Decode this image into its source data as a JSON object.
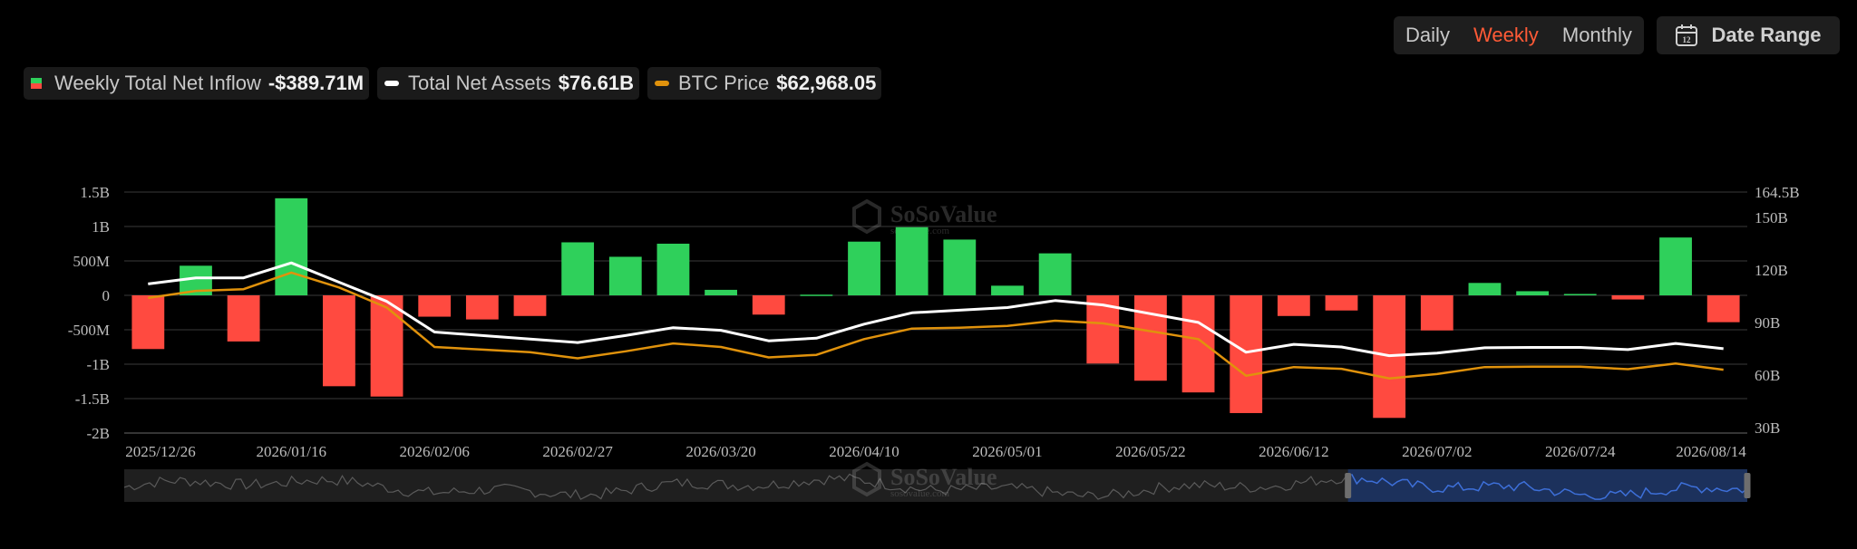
{
  "controls": {
    "periods": [
      "Daily",
      "Weekly",
      "Monthly"
    ],
    "active_period": "Weekly",
    "date_range_label": "Date Range",
    "calendar_icon": "calendar-icon",
    "calendar_icon_text": "12"
  },
  "legend": {
    "inflow_label": "Weekly Total Net Inflow",
    "inflow_value": "-$389.71M",
    "assets_label": "Total Net Assets",
    "assets_value": "$76.61B",
    "btc_label": "BTC Price",
    "btc_value": "$62,968.05"
  },
  "watermark": {
    "brand": "SoSoValue",
    "subtitle": "sosovalue.com"
  },
  "colors": {
    "positive": "#2fd05b",
    "negative": "#ff4a40",
    "assets_line": "#ffffff",
    "btc_line": "#e0920c",
    "accent": "#ff5a36",
    "grid": "#3a3a3a",
    "zoom_fill": "#1c3360"
  },
  "chart_data": {
    "type": "bar",
    "title": "",
    "xlabel": "",
    "ylabel": "",
    "x_tick_labels": [
      "2025/12/26",
      "2026/01/16",
      "2026/02/06",
      "2026/02/27",
      "2026/03/20",
      "2026/04/10",
      "2026/05/01",
      "2026/05/22",
      "2026/06/12",
      "2026/07/02",
      "2026/07/24",
      "2026/08/14"
    ],
    "y_left_ticks": [
      "1.5B",
      "1B",
      "500M",
      "0",
      "-500M",
      "-1B",
      "-1.5B",
      "-2B"
    ],
    "y_left_ticks_values": [
      1500,
      1000,
      500,
      0,
      -500,
      -1000,
      -1500,
      -2000
    ],
    "y_left_unit": "M USD",
    "ylim_left": [
      -2000,
      1500
    ],
    "y_right_ticks": [
      "164.5B",
      "150B",
      "120B",
      "90B",
      "60B",
      "30B"
    ],
    "y_right_ticks_values": [
      164.5,
      150,
      120,
      90,
      60,
      30
    ],
    "ylim_right": [
      26.8,
      164.5
    ],
    "grid": true,
    "legend_position": "top-left",
    "x": [
      "2025/12/26",
      "2026/01/02",
      "2026/01/09",
      "2026/01/16",
      "2026/01/23",
      "2026/01/30",
      "2026/02/06",
      "2026/02/13",
      "2026/02/20",
      "2026/02/27",
      "2026/03/06",
      "2026/03/13",
      "2026/03/20",
      "2026/03/27",
      "2026/04/03",
      "2026/04/10",
      "2026/04/17",
      "2026/04/24",
      "2026/05/01",
      "2026/05/08",
      "2026/05/15",
      "2026/05/22",
      "2026/05/29",
      "2026/06/05",
      "2026/06/12",
      "2026/06/19",
      "2026/06/26",
      "2026/07/02",
      "2026/07/10",
      "2026/07/17",
      "2026/07/24",
      "2026/07/31",
      "2026/08/07",
      "2026/08/14"
    ],
    "series": [
      {
        "name": "Weekly Total Net Inflow",
        "axis": "left",
        "type": "bar",
        "values": [
          -780,
          430,
          -670,
          1410,
          -1320,
          -1470,
          -310,
          -350,
          -300,
          770,
          560,
          750,
          80,
          -280,
          10,
          780,
          990,
          810,
          140,
          610,
          -990,
          -1240,
          -1410,
          -1710,
          -300,
          -220,
          -1780,
          -510,
          180,
          60,
          20,
          -60,
          840,
          -390
        ]
      },
      {
        "name": "Total Net Assets",
        "axis": "right",
        "type": "line",
        "values": [
          112,
          115.5,
          115.5,
          124,
          113,
          102,
          84.5,
          82.5,
          80.5,
          78.5,
          82.5,
          87,
          85.5,
          79.5,
          81,
          89,
          95.5,
          97,
          98.5,
          102.5,
          100,
          95,
          90,
          73,
          77.5,
          76,
          71,
          72.5,
          75.5,
          75.7,
          75.7,
          74.5,
          78,
          75
        ]
      },
      {
        "name": "BTC Price",
        "axis": "right",
        "type": "line",
        "values": [
          104,
          108,
          109,
          118.5,
          110,
          98.5,
          76,
          74.5,
          73,
          69.5,
          73.5,
          78,
          76,
          70,
          71.5,
          80.5,
          86.5,
          87,
          88,
          91,
          89.5,
          85,
          80.5,
          59.5,
          64.5,
          63.5,
          58,
          60.5,
          64.5,
          64.7,
          64.7,
          63.3,
          66.5,
          63
        ]
      }
    ],
    "overview_range": [
      0.754,
      1.0
    ]
  }
}
